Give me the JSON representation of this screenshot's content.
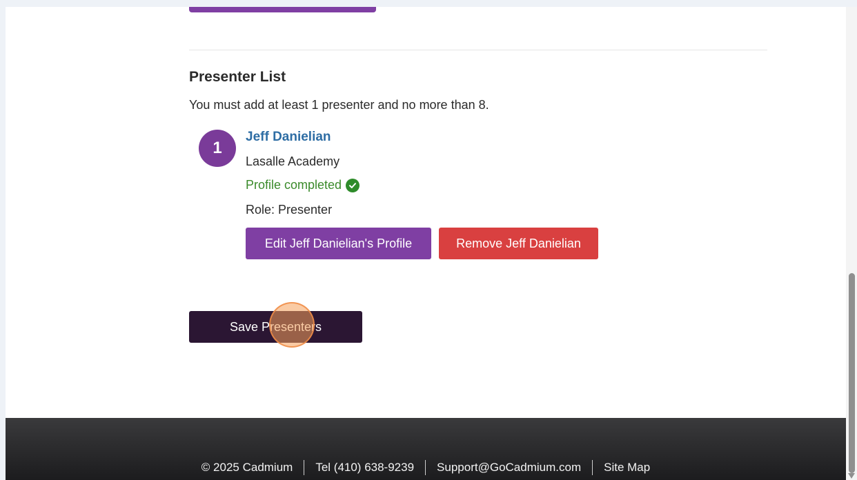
{
  "presenters_section": {
    "title": "Presenter List",
    "instructions": "You must add at least 1 presenter and no more than 8."
  },
  "presenter": {
    "number": "1",
    "name": "Jeff Danielian",
    "organization": "Lasalle Academy",
    "profile_status": "Profile completed",
    "role": "Role: Presenter",
    "edit_label": "Edit Jeff Danielian's Profile",
    "remove_label": "Remove Jeff Danielian"
  },
  "actions": {
    "save_label": "Save Presenters"
  },
  "footer": {
    "copyright": "© 2025 Cadmium",
    "phone": "Tel (410) 638-9239",
    "email": "Support@GoCadmium.com",
    "sitemap": "Site Map"
  },
  "colors": {
    "purple": "#7f3fa3",
    "red": "#d94040",
    "dark_button": "#2b1633",
    "link_blue": "#2e6da4",
    "success_green": "#3a8a2a"
  },
  "icons": {
    "status": "check-circle-icon"
  }
}
